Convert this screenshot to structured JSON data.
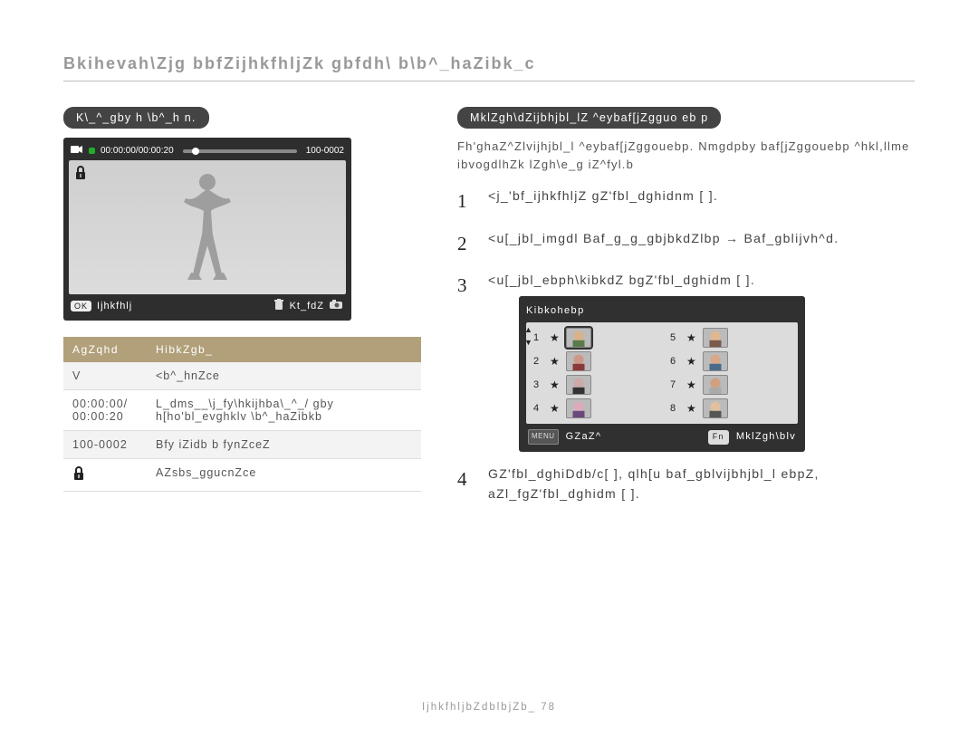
{
  "page_title": "Bkihevah\\Zjg bbfZijhkfhljZk gbfdh\\ b\\b^_haZibk_c",
  "left": {
    "pill": "K\\_^_gby h \\b^_h n.",
    "video": {
      "time_label": "00:00:00/00:00:20",
      "code": "100-0002",
      "lock_icon": "lock-icon",
      "bottom_ok": "OK",
      "bottom_left": "Ijhkfhlj",
      "bottom_right": "Kt_fdZ",
      "trash_icon": "trash-icon",
      "cam_icon": "camera-icon"
    },
    "table": {
      "head": [
        "AgZqhd",
        "HibkZgb_"
      ],
      "rows": [
        {
          "a": "V",
          "b": "<b^_hnZce"
        },
        {
          "a": "00:00:00/\n00:00:20",
          "b": "L_dms__\\j_fy\\hkijhba\\_^_/ gby h[ho'bl_evghklv \\b^_haZibkb"
        },
        {
          "a": "100-0002",
          "b": "Bfy iZidb b fynZceZ"
        },
        {
          "a_icon": "lock-icon",
          "b": "AZsbs_ggucnZce"
        }
      ]
    }
  },
  "right": {
    "pill": "MklZgh\\dZijbhjbl_lZ ^eybaf[jZgguo eb p",
    "intro": "Fh'ghaZ^Zlvijhjbl_l ^eybaf[jZggouebp. Nmgdpby baf[jZggouebp ^hkl,llme ibvogdlhZk lZgh\\e_g iZ^fyl.b",
    "steps": [
      "<j_'bf_ijhkfhljZ gZ'fbl_dghidnm [     ].",
      "<u[_jbl_imgdl Baf_g_g_gbjbkdZlbp → Baf_gblijvh^d.",
      "<u[_jbl_ebph\\kibkdZ bgZ'fbl_dghidm [    ].",
      "GZ'fbl_dghiDdb/c[ ], qlh[u baf_gblvijbhjbl_l ebpZ, aZl_fgZ'fbl_dghidm [    ]."
    ],
    "panel": {
      "title": "Kibkohebp",
      "numbers": [
        "1",
        "2",
        "3",
        "4",
        "5",
        "6",
        "7",
        "8"
      ],
      "menu_label": "MENU",
      "back_label": "GZaZ^",
      "fn_label": "Fn",
      "set_label": "MklZgh\\blv"
    }
  },
  "footer": "IjhkfhljbZdblbjZb_ 78"
}
